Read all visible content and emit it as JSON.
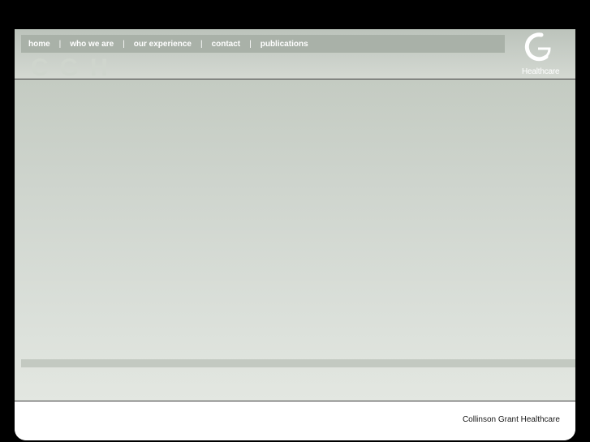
{
  "nav": {
    "items": [
      {
        "label": "home"
      },
      {
        "label": "who we are"
      },
      {
        "label": "our experience"
      },
      {
        "label": "contact"
      },
      {
        "label": "publications"
      }
    ],
    "separator": "|"
  },
  "logo": {
    "text": "Healthcare",
    "icon": "cg-logo-icon"
  },
  "footer": {
    "company": "Collinson Grant Healthcare"
  },
  "colors": {
    "background": "#000000",
    "header": "#c4cbc2",
    "nav_bar": "#a9b1a8",
    "content_top": "#c4cbc2",
    "content_bottom": "#e3e7e1"
  }
}
